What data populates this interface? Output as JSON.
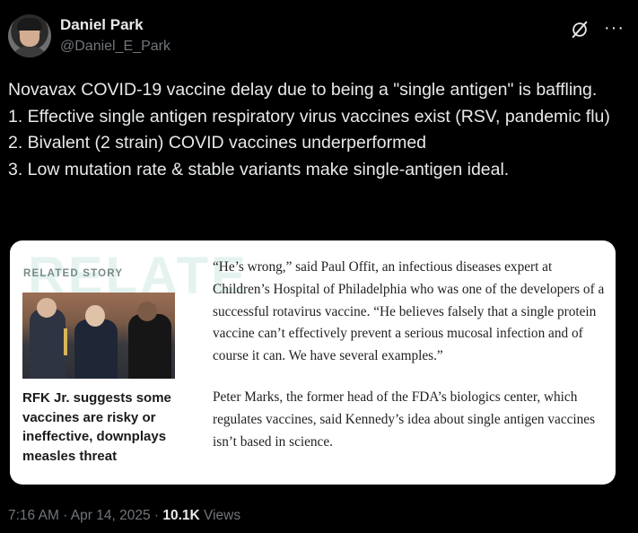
{
  "author": {
    "name": "Daniel Park",
    "handle": "@Daniel_E_Park"
  },
  "tweet": {
    "text": "Novavax COVID-19 vaccine delay due to being a \"single antigen\" is baffling.\n1. Effective single antigen respiratory virus vaccines exist (RSV, pandemic flu)\n2. Bivalent (2 strain) COVID vaccines underperformed\n3. Low mutation rate & stable variants make single-antigen ideal."
  },
  "card": {
    "label": "RELATED STORY",
    "watermark": "RELATE",
    "headline": "RFK Jr. suggests some vaccines are risky or ineffective, downplays measles threat",
    "paragraph1": "“He’s wrong,” said Paul Offit, an infectious diseases expert at Children’s Hospital of Philadelphia who was one of the developers of a successful rotavirus vaccine. “He believes falsely that a single protein vaccine can’t effectively prevent a serious mucosal infection and of course it can. We have several examples.”",
    "paragraph2": "Peter Marks, the former head of the FDA’s biologics center, which regulates vaccines, said Kennedy’s idea about single antigen vaccines isn’t based in science."
  },
  "meta": {
    "time": "7:16 AM",
    "separator": " · ",
    "date": "Apr 14, 2025",
    "views_count": "10.1K",
    "views_label": " Views"
  },
  "icons": {
    "grok": "grok-icon",
    "more": "more-icon"
  }
}
